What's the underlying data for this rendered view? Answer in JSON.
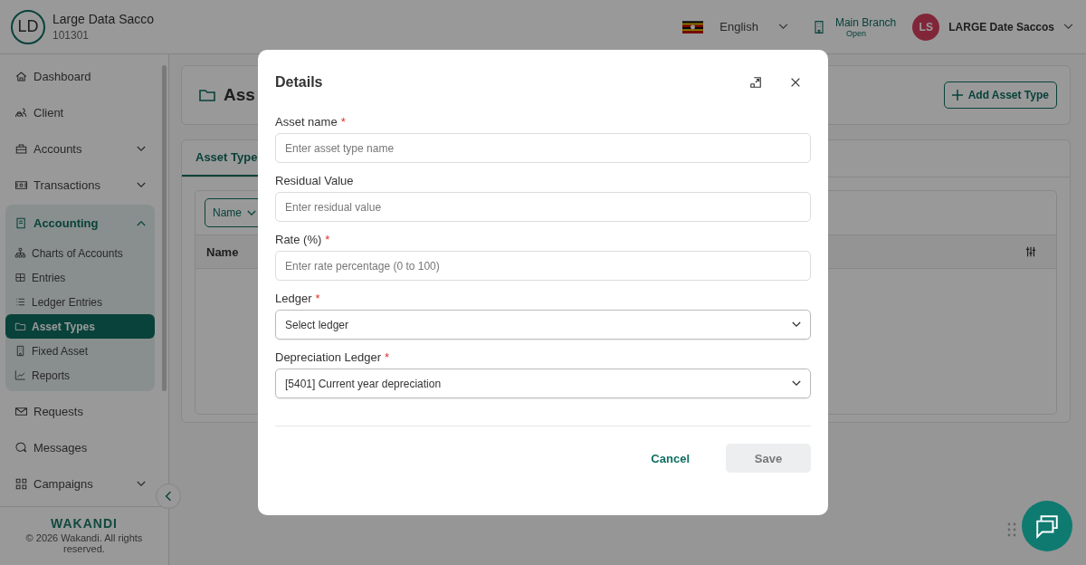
{
  "header": {
    "org": {
      "initials": "LD",
      "name": "Large Data Sacco",
      "code": "101301"
    },
    "language": "English",
    "branch": {
      "name": "Main Branch",
      "status": "Open"
    },
    "user": {
      "initials": "LS",
      "name": "LARGE Date Saccos"
    }
  },
  "sidebar": {
    "items": [
      {
        "label": "Dashboard"
      },
      {
        "label": "Client"
      },
      {
        "label": "Accounts",
        "expanded": false
      },
      {
        "label": "Transactions",
        "expanded": false
      },
      {
        "label": "Accounting",
        "expanded": true,
        "children": [
          {
            "label": "Charts of Accounts",
            "selected": false
          },
          {
            "label": "Entries",
            "selected": false
          },
          {
            "label": "Ledger Entries",
            "selected": false
          },
          {
            "label": "Asset Types",
            "selected": true
          },
          {
            "label": "Fixed Asset",
            "selected": false
          },
          {
            "label": "Reports",
            "selected": false
          }
        ]
      },
      {
        "label": "Requests"
      },
      {
        "label": "Messages"
      },
      {
        "label": "Campaigns",
        "expanded": false
      }
    ],
    "brand": "WAKANDI",
    "copyright": "© 2026 Wakandi. All rights reserved."
  },
  "page": {
    "title": "Ass",
    "add_button": "Add Asset Type",
    "tabs": [
      {
        "label": "Asset Type",
        "selected": true
      }
    ],
    "filter": "Name",
    "columns": [
      "Name"
    ]
  },
  "modal": {
    "title": "Details",
    "fields": [
      {
        "kind": "input",
        "label": "Asset name",
        "required_mark": "*",
        "placeholder": "Enter asset type name"
      },
      {
        "kind": "input",
        "label": "Residual Value",
        "placeholder": "Enter residual value"
      },
      {
        "kind": "input",
        "label": "Rate (%)",
        "required_mark": "*",
        "placeholder": "Enter rate percentage (0 to 100)"
      },
      {
        "kind": "select",
        "label": "Ledger",
        "required_mark": "*",
        "value": "Select ledger"
      },
      {
        "kind": "select",
        "label": "Depreciation Ledger",
        "required_mark": "*",
        "value": "[5401] Current year depreciation"
      }
    ],
    "cancel": "Cancel",
    "save": {
      "label": "Save",
      "disabled": true
    }
  }
}
